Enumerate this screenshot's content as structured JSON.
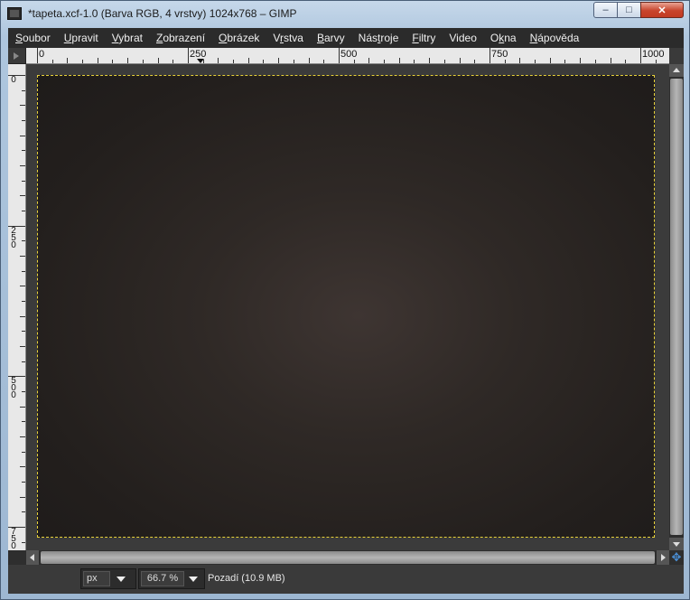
{
  "window": {
    "title": "*tapeta.xcf-1.0 (Barva RGB, 4 vrstvy) 1024x768 – GIMP",
    "controls": {
      "minimize": "–",
      "maximize": "□",
      "close": "✕"
    }
  },
  "menubar": {
    "items": [
      {
        "pre": "",
        "u": "S",
        "post": "oubor"
      },
      {
        "pre": "",
        "u": "U",
        "post": "pravit"
      },
      {
        "pre": "",
        "u": "V",
        "post": "ybrat"
      },
      {
        "pre": "",
        "u": "Z",
        "post": "obrazení"
      },
      {
        "pre": "",
        "u": "O",
        "post": "brázek"
      },
      {
        "pre": "V",
        "u": "r",
        "post": "stva"
      },
      {
        "pre": "",
        "u": "B",
        "post": "arvy"
      },
      {
        "pre": "Nás",
        "u": "t",
        "post": "roje"
      },
      {
        "pre": "",
        "u": "F",
        "post": "iltry"
      },
      {
        "pre": "Video",
        "u": "",
        "post": ""
      },
      {
        "pre": "O",
        "u": "k",
        "post": "na"
      },
      {
        "pre": "",
        "u": "N",
        "post": "ápověda"
      }
    ]
  },
  "rulers": {
    "horizontal_labels": [
      "0",
      "250",
      "500",
      "750",
      "1000"
    ],
    "vertical_labels": [
      "0",
      "250",
      "500",
      "750"
    ]
  },
  "statusbar": {
    "unit": "px",
    "zoom": "66.7 %",
    "layer_info": "Pozadí (10.9 MB)"
  },
  "colors": {
    "selection_border": "#e8d23a",
    "canvas_center": "#3e3532",
    "canvas_edge": "#1e1b1a",
    "nav_icon": "#4a8fd6"
  },
  "icons": {
    "navigate": "navigate-icon"
  }
}
